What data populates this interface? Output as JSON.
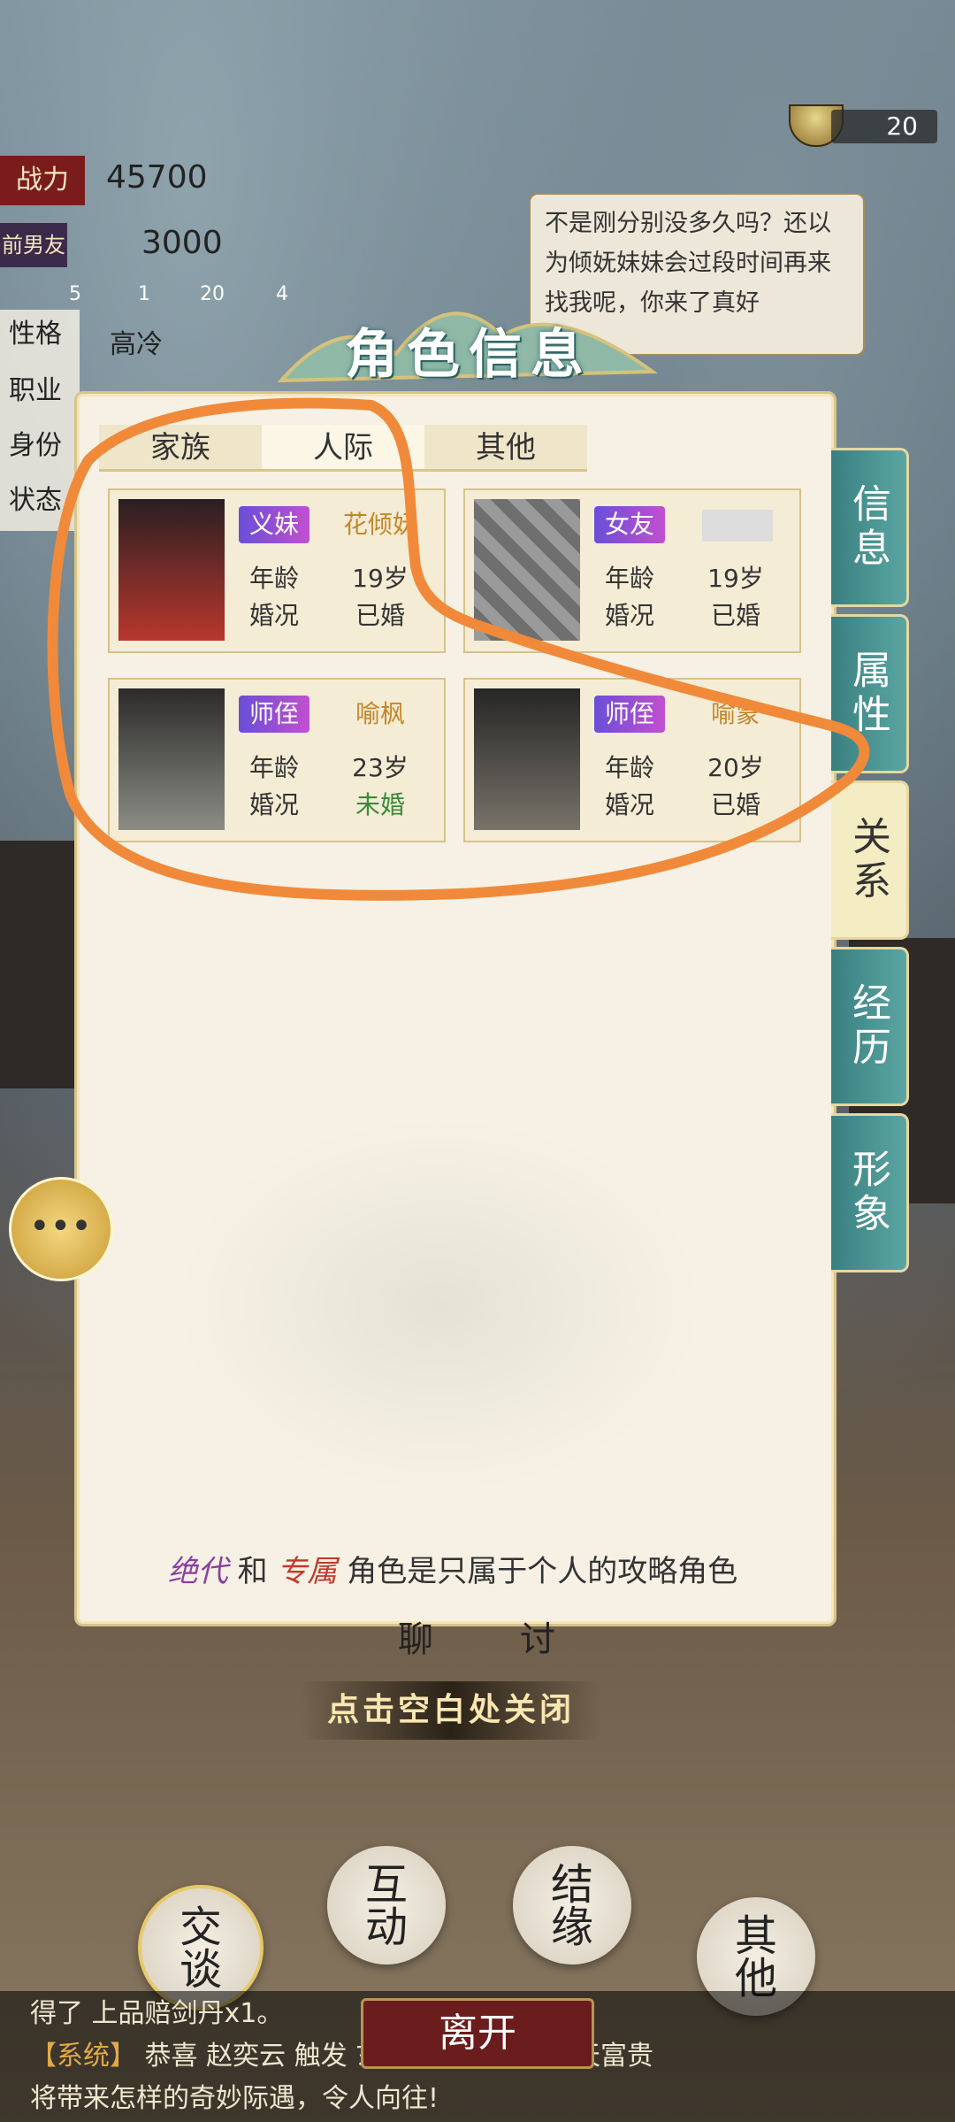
{
  "currency": {
    "value": "20"
  },
  "stats": {
    "power_label": "战力",
    "power_value": "45700",
    "exbf_label": "前男友",
    "exbf_value": "3000",
    "mini_counts": [
      "5",
      "1",
      "20",
      "4"
    ],
    "rows": [
      {
        "label": "性格",
        "value": "高冷"
      },
      {
        "label": "职业",
        "value": ""
      },
      {
        "label": "身份",
        "value": ""
      },
      {
        "label": "状态",
        "value": ""
      }
    ]
  },
  "speech": {
    "text": "不是刚分别没多久吗？还以为倾妩妹妹会过段时间再来找我呢，你来了真好"
  },
  "dialog": {
    "title": "角色信息",
    "tabs": [
      "家族",
      "人际",
      "其他"
    ],
    "cards": [
      {
        "badge": "义妹",
        "name": "花倾妩",
        "age_label": "年龄",
        "age": "19岁",
        "marital_label": "婚况",
        "marital": "已婚"
      },
      {
        "badge": "女友",
        "name": "",
        "age_label": "年龄",
        "age": "19岁",
        "marital_label": "婚况",
        "marital": "已婚"
      },
      {
        "badge": "师侄",
        "name": "喻枫",
        "age_label": "年龄",
        "age": "23岁",
        "marital_label": "婚况",
        "marital": "未婚"
      },
      {
        "badge": "师侄",
        "name": "喻蒙",
        "age_label": "年龄",
        "age": "20岁",
        "marital_label": "婚况",
        "marital": "已婚"
      }
    ],
    "side_tabs": [
      "信息",
      "属性",
      "关系",
      "经历",
      "形象"
    ],
    "footer_note": {
      "em1": "绝代",
      "mid": "和",
      "em2": "专属",
      "rest": "角色是只属于个人的攻略角色"
    }
  },
  "behind_text": [
    "聊",
    "讨"
  ],
  "close_hint": "点击空白处关闭",
  "actions": [
    "交谈",
    "互动",
    "结缘",
    "其他"
  ],
  "leave_button": "离开",
  "log": {
    "line1": "得了 上品赔剑丹x1。",
    "line2_tag": "【系统】",
    "line2": "恭喜 赵奕云 触发 玄精铁x1，此等泼天富贵",
    "line3": "将带来怎样的奇妙际遇，令人向往!"
  },
  "colors": {
    "accent_red": "#7b1c1c",
    "teal": "#3a7f80",
    "annotation": "#f08a3a"
  }
}
